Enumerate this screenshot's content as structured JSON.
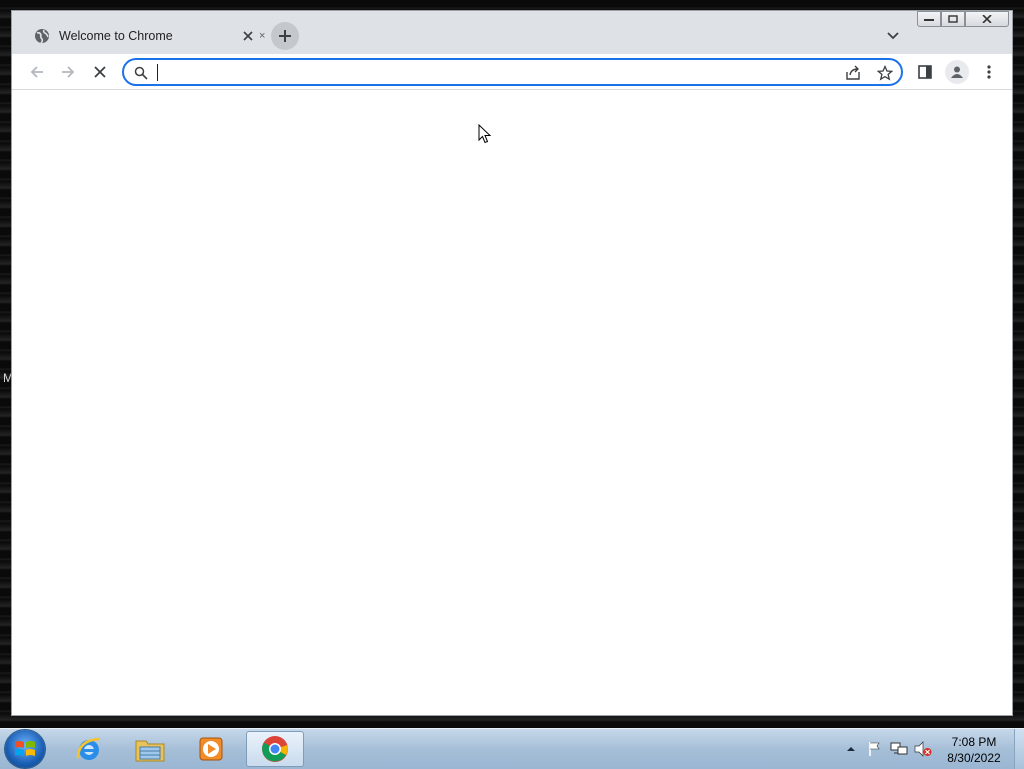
{
  "desktop": {
    "edge_letter": "M"
  },
  "browser": {
    "tab": {
      "title": "Welcome to Chrome",
      "icon": "globe-icon"
    },
    "tab_peek_close": "×",
    "omnibox": {
      "value": "",
      "placeholder": ""
    }
  },
  "colors": {
    "accent": "#1a73e8",
    "titlebar": "#dee1e6"
  },
  "taskbar": {
    "items": [
      "internet-explorer-icon",
      "file-explorer-icon",
      "media-player-icon",
      "chrome-icon"
    ],
    "clock": {
      "time": "7:08 PM",
      "date": "8/30/2022"
    }
  }
}
